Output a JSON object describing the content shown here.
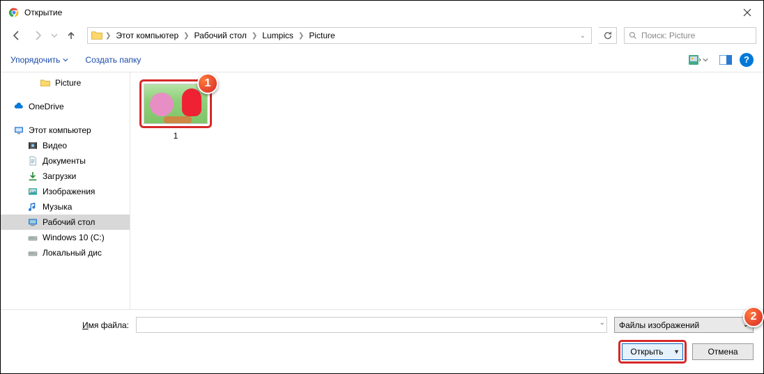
{
  "title": "Открытие",
  "breadcrumb": [
    "Этот компьютер",
    "Рабочий стол",
    "Lumpics",
    "Picture"
  ],
  "search_placeholder": "Поиск: Picture",
  "toolbar": {
    "organize": "Упорядочить",
    "new_folder": "Создать папку"
  },
  "tree": [
    {
      "label": "Picture",
      "icon": "folder",
      "lvl": 2
    },
    {
      "spacer": true
    },
    {
      "label": "OneDrive",
      "icon": "onedrive",
      "lvl": 0
    },
    {
      "spacer": true
    },
    {
      "label": "Этот компьютер",
      "icon": "pc",
      "lvl": 0
    },
    {
      "label": "Видео",
      "icon": "video",
      "lvl": 1
    },
    {
      "label": "Документы",
      "icon": "docs",
      "lvl": 1
    },
    {
      "label": "Загрузки",
      "icon": "downloads",
      "lvl": 1
    },
    {
      "label": "Изображения",
      "icon": "images",
      "lvl": 1
    },
    {
      "label": "Музыка",
      "icon": "music",
      "lvl": 1
    },
    {
      "label": "Рабочий стол",
      "icon": "desktop",
      "lvl": 1,
      "selected": true
    },
    {
      "label": "Windows 10 (C:)",
      "icon": "drive",
      "lvl": 1
    },
    {
      "label": "Локальный дис",
      "icon": "drive",
      "lvl": 1
    }
  ],
  "file": {
    "name": "1"
  },
  "footer": {
    "filename_label_prefix": "И",
    "filename_label_rest": "мя файла:",
    "filename_value": "",
    "filter": "Файлы изображений",
    "open": "Открыть",
    "cancel": "Отмена"
  },
  "badges": {
    "one": "1",
    "two": "2"
  }
}
